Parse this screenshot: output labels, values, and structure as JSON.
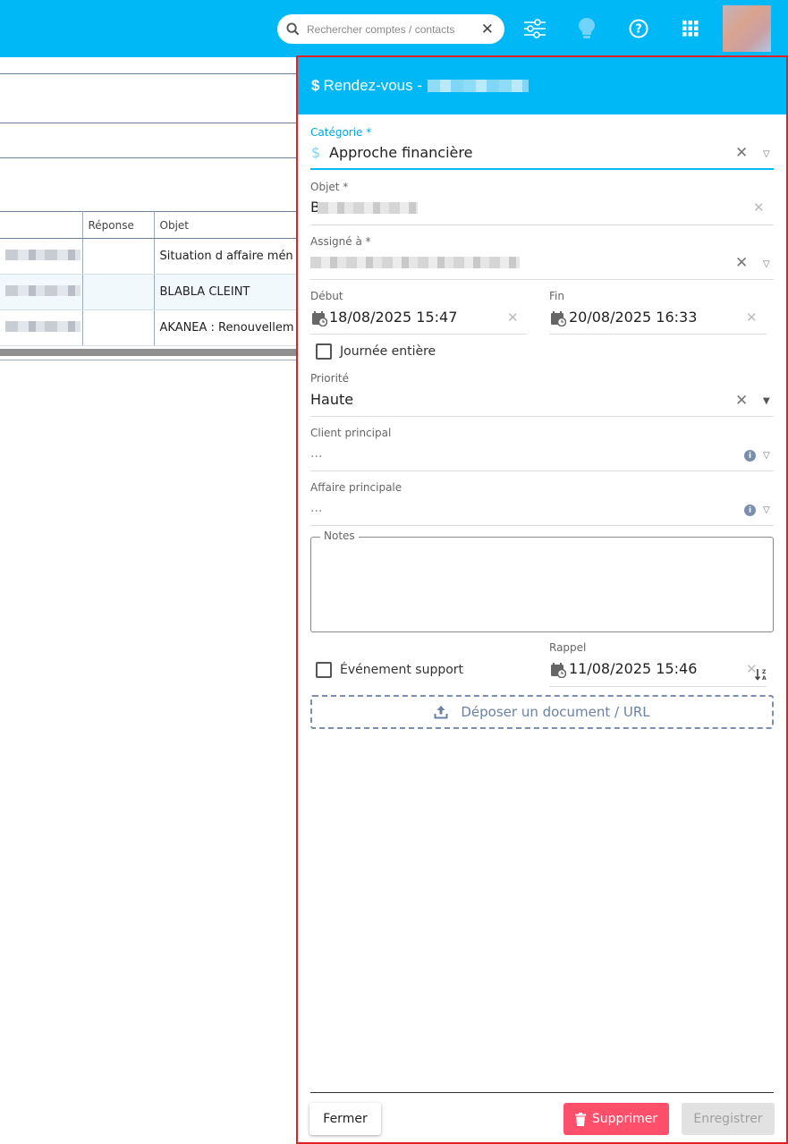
{
  "topbar": {
    "search_placeholder": "Rechercher comptes / contacts",
    "icons": [
      "search-icon",
      "close-icon",
      "sliders-icon",
      "lightbulb-icon",
      "help-icon",
      "apps-grid-icon"
    ],
    "accent": "#00b8f5"
  },
  "grid": {
    "headers": [
      "",
      "Réponse",
      "Objet"
    ],
    "rows": [
      {
        "objet": "Situation d affaire mén"
      },
      {
        "objet": "BLABLA CLEINT"
      },
      {
        "objet": "AKANEA : Renouvellem"
      }
    ]
  },
  "panel": {
    "title": "Rendez-vous -",
    "categorie": {
      "label": "Catégorie *",
      "value": "Approche financière"
    },
    "objet": {
      "label": "Objet *",
      "value_prefix": "B"
    },
    "assigne": {
      "label": "Assigné à *"
    },
    "debut": {
      "label": "Début",
      "value": "18/08/2025 15:47"
    },
    "fin": {
      "label": "Fin",
      "value": "20/08/2025 16:33"
    },
    "journee": {
      "label": "Journée entière",
      "checked": false
    },
    "priorite": {
      "label": "Priorité",
      "value": "Haute"
    },
    "client": {
      "label": "Client principal",
      "placeholder": "..."
    },
    "affaire": {
      "label": "Affaire principale",
      "placeholder": "..."
    },
    "notes": {
      "label": "Notes",
      "value": ""
    },
    "support": {
      "label": "Événement support",
      "checked": false
    },
    "rappel": {
      "label": "Rappel",
      "value": "11/08/2025 15:46"
    },
    "dropzone": "Déposer un document / URL",
    "buttons": {
      "close": "Fermer",
      "delete": "Supprimer",
      "save": "Enregistrer"
    },
    "colors": {
      "header": "#00b8f5",
      "delete": "#ff4f6b",
      "border": "#e2202a"
    }
  }
}
